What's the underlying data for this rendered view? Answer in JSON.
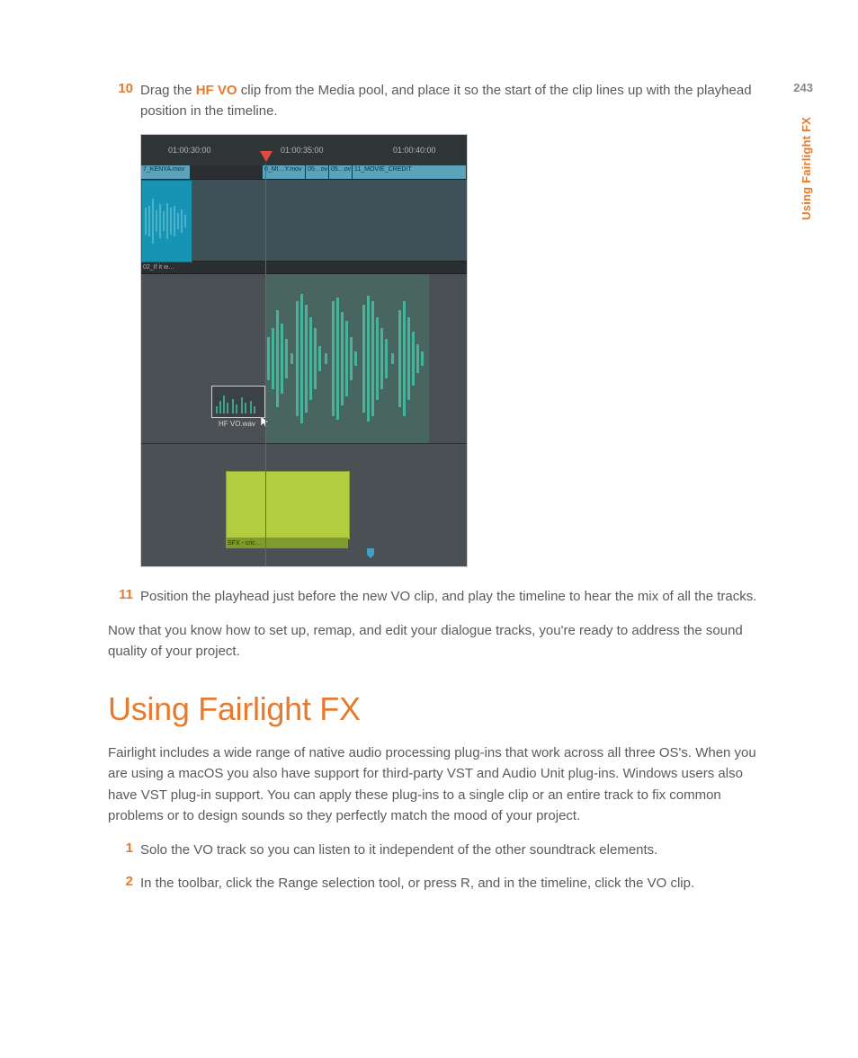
{
  "page_number": "243",
  "side_title": "Using Fairlight FX",
  "step10": {
    "num": "10",
    "pre": "Drag the ",
    "hl": "HF VO",
    "post": " clip from the Media pool, and place it so the start of the clip lines up with the playhead position in the timeline."
  },
  "timeline": {
    "timecodes": [
      "01:00:30:00",
      "01:00:35:00",
      "01:00:40:00"
    ],
    "video_clips": [
      "7_KENYA.mov",
      "0_MI…Y.mov",
      "05…ov",
      "05…ov",
      "11_MOVIE_CREDIT"
    ],
    "audio_label": "02_If it w…",
    "drag_label": "HF VO.wav",
    "sfx_label": "SFX - cric…"
  },
  "step11": {
    "num": "11",
    "text": "Position the playhead just before the new VO clip, and play the timeline to hear the mix of all the tracks."
  },
  "transition": "Now that you know how to set up, remap, and edit your dialogue tracks, you're ready to address the sound quality of your project.",
  "section_title": "Using Fairlight FX",
  "section_body": "Fairlight includes a wide range of native audio processing plug-ins that work across all three OS's. When you are using a macOS you also have support for third-party VST and Audio Unit plug-ins. Windows users also have VST plug-in support. You can apply these plug-ins to a single clip or an entire track to fix common problems or to design sounds so they perfectly match the mood of your project.",
  "fx_step1": {
    "num": "1",
    "text": "Solo the VO track so you can listen to it independent of the other soundtrack elements."
  },
  "fx_step2": {
    "num": "2",
    "text": "In the toolbar, click the Range selection tool, or press R, and in the timeline, click the VO clip."
  }
}
